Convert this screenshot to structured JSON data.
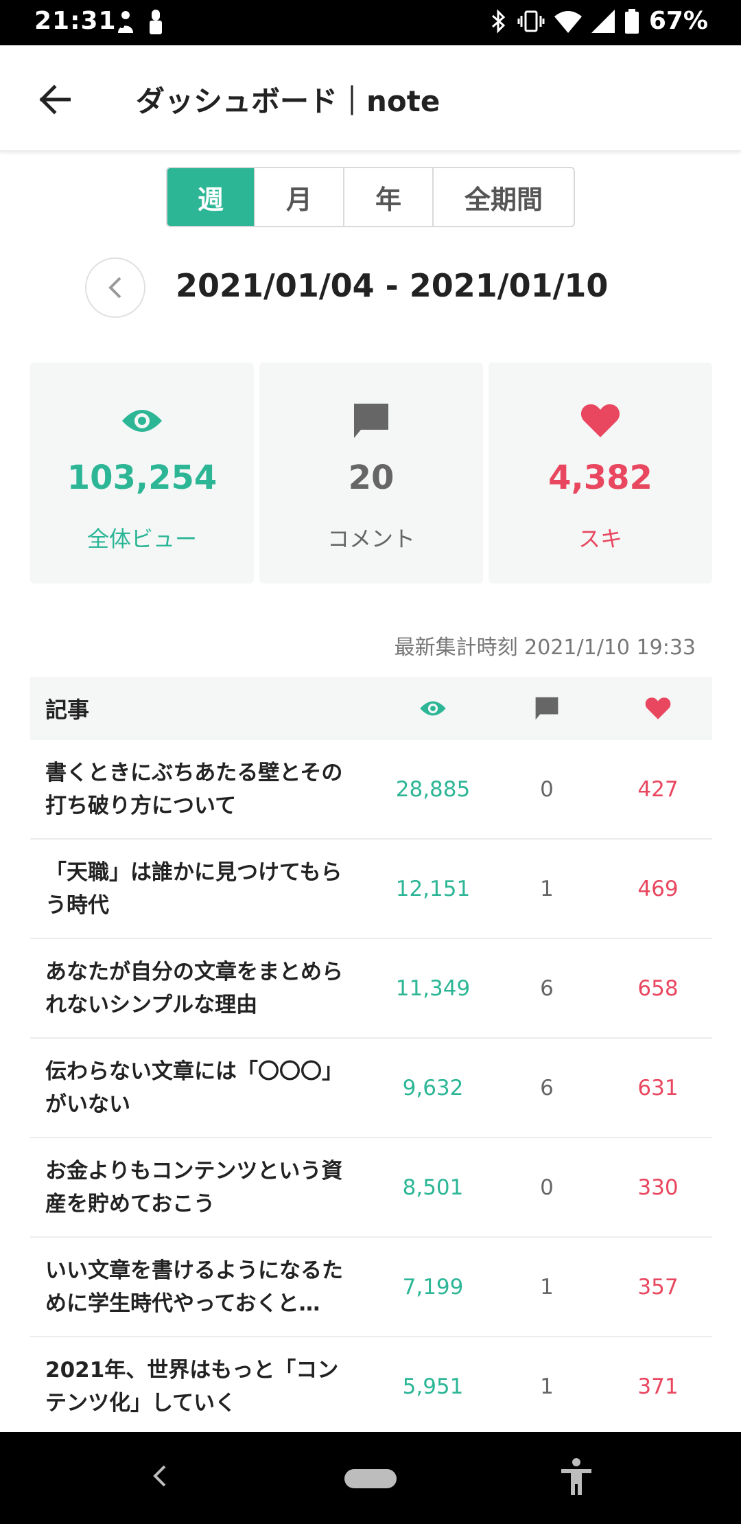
{
  "status_bar": {
    "time": "21:31",
    "battery": "67%"
  },
  "header": {
    "title": "ダッシュボード｜note",
    "back_icon": "arrow-left-icon"
  },
  "tabs": [
    {
      "label": "週",
      "active": true
    },
    {
      "label": "月",
      "active": false
    },
    {
      "label": "年",
      "active": false
    },
    {
      "label": "全期間",
      "active": false
    }
  ],
  "date_range": "2021/01/04 - 2021/01/10",
  "stats": {
    "views": {
      "value": "103,254",
      "label": "全体ビュー",
      "color": "#2cb696"
    },
    "comments": {
      "value": "20",
      "label": "コメント",
      "color": "#666666"
    },
    "likes": {
      "value": "4,382",
      "label": "スキ",
      "color": "#e8475f"
    }
  },
  "updated_at": "最新集計時刻 2021/1/10 19:33",
  "table": {
    "header": {
      "title": "記事"
    },
    "rows": [
      {
        "title": "書くときにぶちあたる壁とその打ち破り方について",
        "views": "28,885",
        "comments": "0",
        "likes": "427"
      },
      {
        "title": "「天職」は誰かに見つけてもらう時代",
        "views": "12,151",
        "comments": "1",
        "likes": "469"
      },
      {
        "title": "あなたが自分の文章をまとめられないシンプルな理由",
        "views": "11,349",
        "comments": "6",
        "likes": "658"
      },
      {
        "title": "伝わらない文章には「〇〇〇」がいない",
        "views": "9,632",
        "comments": "6",
        "likes": "631"
      },
      {
        "title": "お金よりもコンテンツという資産を貯めておこう",
        "views": "8,501",
        "comments": "0",
        "likes": "330"
      },
      {
        "title": "いい文章を書けるようになるために学生時代やっておくと…",
        "views": "7,199",
        "comments": "1",
        "likes": "357"
      },
      {
        "title": "2021年、世界はもっと「コンテンツ化」していく",
        "views": "5,951",
        "comments": "1",
        "likes": "371"
      }
    ]
  },
  "colors": {
    "accent": "#2cb696",
    "like": "#e8475f",
    "neutral": "#666666"
  }
}
